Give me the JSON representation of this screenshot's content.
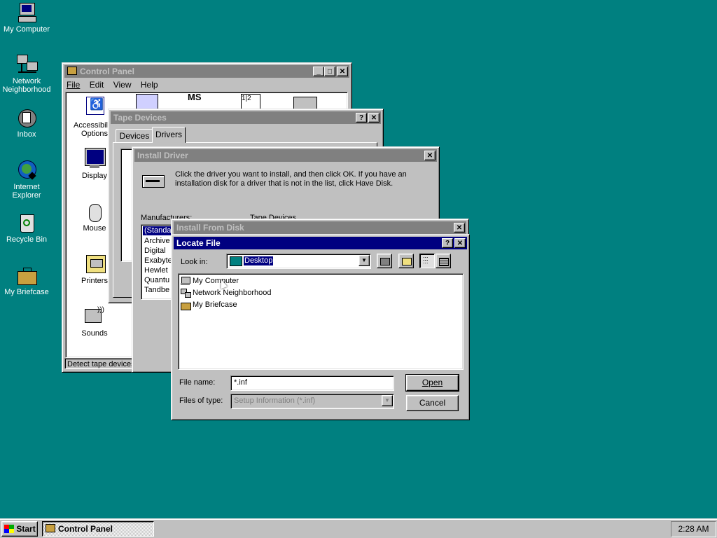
{
  "desktop": {
    "icons": [
      {
        "label": "My Computer",
        "icon": "my-computer-icon"
      },
      {
        "label": "Network Neighborhood",
        "icon": "network-neighborhood-icon"
      },
      {
        "label": "Inbox",
        "icon": "inbox-icon"
      },
      {
        "label": "Internet Explorer",
        "icon": "internet-explorer-icon"
      },
      {
        "label": "Recycle Bin",
        "icon": "recycle-bin-icon"
      },
      {
        "label": "My Briefcase",
        "icon": "briefcase-icon"
      }
    ],
    "background": "#008080"
  },
  "control_panel": {
    "title": "Control Panel",
    "menu": [
      "File",
      "Edit",
      "View",
      "Help"
    ],
    "items": [
      "Accessibility Options",
      "Display",
      "Mouse",
      "Printers",
      "Sounds"
    ],
    "status": "Detect tape devices"
  },
  "tape_devices": {
    "title": "Tape Devices",
    "tabs": [
      "Devices",
      "Drivers"
    ]
  },
  "install_driver": {
    "title": "Install Driver",
    "message": "Click the driver you want to install, and then click OK. If you have an installation disk for a driver that is not in the list, click Have Disk.",
    "manufacturers_label": "Manufacturers:",
    "tape_devices_label": "Tape Devices",
    "manufacturers": [
      "(Standa",
      "Archive",
      "Digital",
      "Exabyte",
      "Hewlet",
      "Quantu",
      "Tandbe"
    ]
  },
  "install_from_disk": {
    "title": "Install From Disk"
  },
  "locate_file": {
    "title": "Locate File",
    "look_in_label": "Look in:",
    "look_in_value": "Desktop",
    "files": [
      {
        "name": "My Computer",
        "icon": "computer-small-icon"
      },
      {
        "name": "Network Neighborhood",
        "icon": "network-small-icon"
      },
      {
        "name": "My Briefcase",
        "icon": "briefcase-small-icon"
      }
    ],
    "file_name_label": "File name:",
    "file_name_value": "*.inf",
    "files_of_type_label": "Files of type:",
    "files_of_type_value": "Setup Information (*.inf)",
    "open_label": "Open",
    "cancel_label": "Cancel"
  },
  "taskbar": {
    "start_label": "Start",
    "task_label": "Control Panel",
    "clock": "2:28 AM"
  },
  "colors": {
    "active_title": "#000080",
    "inactive_title": "#808080",
    "face": "#c0c0c0"
  }
}
